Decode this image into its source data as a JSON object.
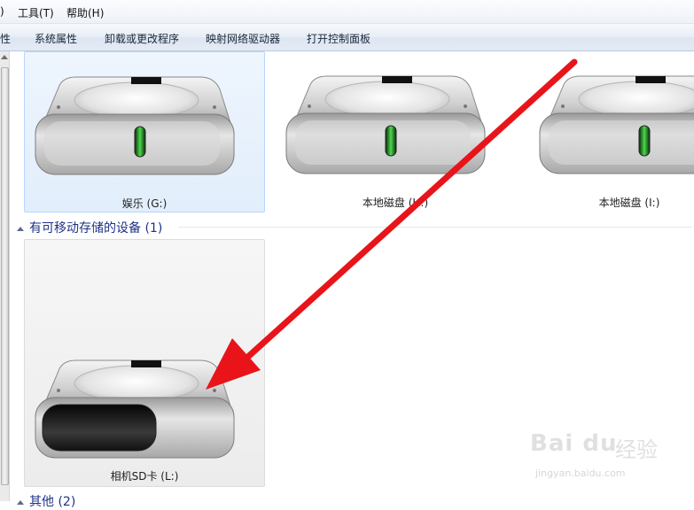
{
  "menu": {
    "partial_paren": ")",
    "tools": "工具(T)",
    "help": "帮助(H)"
  },
  "toolbar": {
    "partial_properties": "性",
    "system_properties": "系统属性",
    "uninstall": "卸载或更改程序",
    "map_drive": "映射网络驱动器",
    "control_panel": "打开控制面板"
  },
  "drives": [
    {
      "label": "娱乐 (G:)",
      "selected": true
    },
    {
      "label": "本地磁盘 (H:)",
      "selected": false
    },
    {
      "label": "本地磁盘 (I:)",
      "selected": false
    }
  ],
  "removable_group": {
    "title": "有可移动存储的设备 (1)",
    "items": [
      {
        "label": "相机SD卡 (L:)"
      }
    ]
  },
  "other_group": {
    "title": "其他 (2)"
  },
  "colors": {
    "selection_bg": "#e2eefc",
    "selection_border": "#b8d6fb",
    "group_header": "#1e3287",
    "arrow": "#e8141a",
    "led": "#4cd84c"
  },
  "icons": {
    "hard_drive": "hard-drive-icon",
    "removable_drive": "removable-drive-icon",
    "collapse": "collapse-triangle-icon",
    "arrow": "red-arrow-annotation"
  },
  "watermark": {
    "brand": "Bai du",
    "cn": "经验",
    "url": "jingyan.baidu.com"
  }
}
